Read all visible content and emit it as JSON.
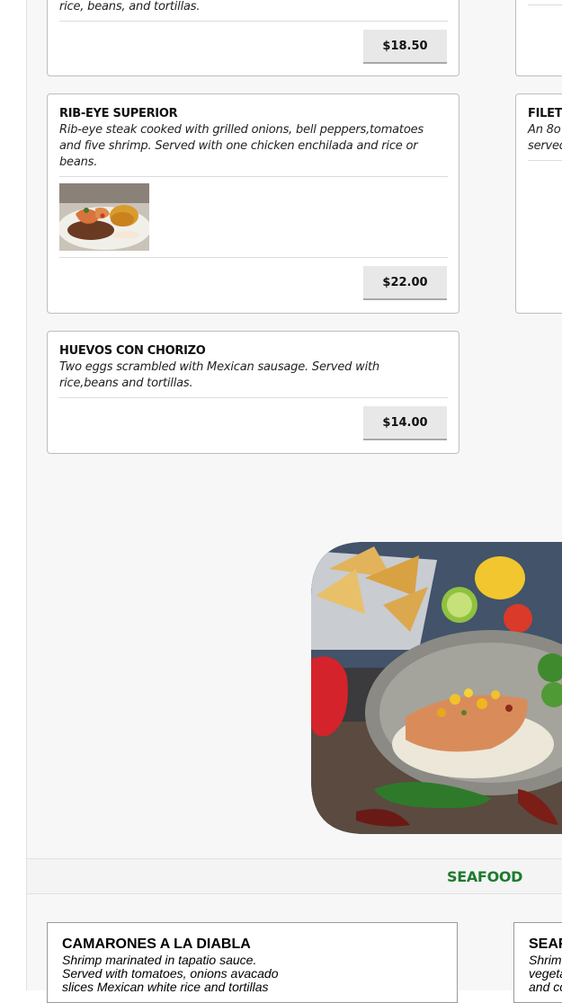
{
  "top_card": {
    "desc_tail": "rice, beans, and tortillas.",
    "price": "$18.50"
  },
  "rib_eye": {
    "title": "RIB-EYE SUPERIOR",
    "desc": "Rib-eye steak cooked with grilled onions, bell peppers,tomatoes and five shrimp. Served with one chicken enchilada and rice or beans.",
    "price": "$22.00"
  },
  "filet": {
    "title": "FILET",
    "desc_line1": "An 8o",
    "desc_line2": "served"
  },
  "huevos": {
    "title": "HUEVOS CON CHORIZO",
    "desc": "Two eggs scrambled with Mexican sausage. Served with rice,beans and tortillas.",
    "price": "$14.00"
  },
  "section": {
    "title": "SEAFOOD"
  },
  "camarones": {
    "title": "CAMARONES A LA DIABLA",
    "desc": "Shrimp marinated in tapatio sauce. Served with tomatoes, onions avacado slices Mexican white rice and tortillas"
  },
  "seafood_right": {
    "title": "SEAF",
    "desc_line1": "Shrim",
    "desc_line2": "vegeta",
    "desc_line3": "and co"
  },
  "colors": {
    "section_green": "#1e7a2e",
    "price_button": "#e8e8e8"
  }
}
